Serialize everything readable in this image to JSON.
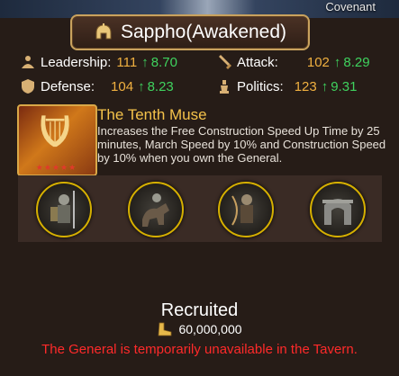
{
  "covenant_label": "Covenant",
  "general": {
    "name": "Sappho(Awakened)"
  },
  "stats": {
    "leadership": {
      "label": "Leadership:",
      "value": "111",
      "bonus": "8.70",
      "icon": "leadership-icon"
    },
    "attack": {
      "label": "Attack:",
      "value": "102",
      "bonus": "8.29",
      "icon": "sword-icon"
    },
    "defense": {
      "label": "Defense:",
      "value": "104",
      "bonus": "8.23",
      "icon": "shield-icon"
    },
    "politics": {
      "label": "Politics:",
      "value": "123",
      "bonus": "9.31",
      "icon": "chess-icon"
    }
  },
  "skill": {
    "title": "The Tenth Muse",
    "description": "Increases the Free Construction Speed Up Time by 25 minutes, March Speed by 10% and Construction Speed by 10% when you own the General.",
    "stars": 5,
    "icon": "lyre-icon"
  },
  "troops": [
    "infantry-icon",
    "cavalry-icon",
    "archer-icon",
    "siege-icon"
  ],
  "status": {
    "label": "Recruited",
    "cost": "60,000,000",
    "cost_icon": "boot-icon",
    "warning": "The General is temporarily unavailable in the Tavern."
  },
  "colors": {
    "stat_value": "#f0b040",
    "bonus": "#3fd25e",
    "skill_title": "#f4c24a",
    "warning": "#ff2a2a"
  }
}
